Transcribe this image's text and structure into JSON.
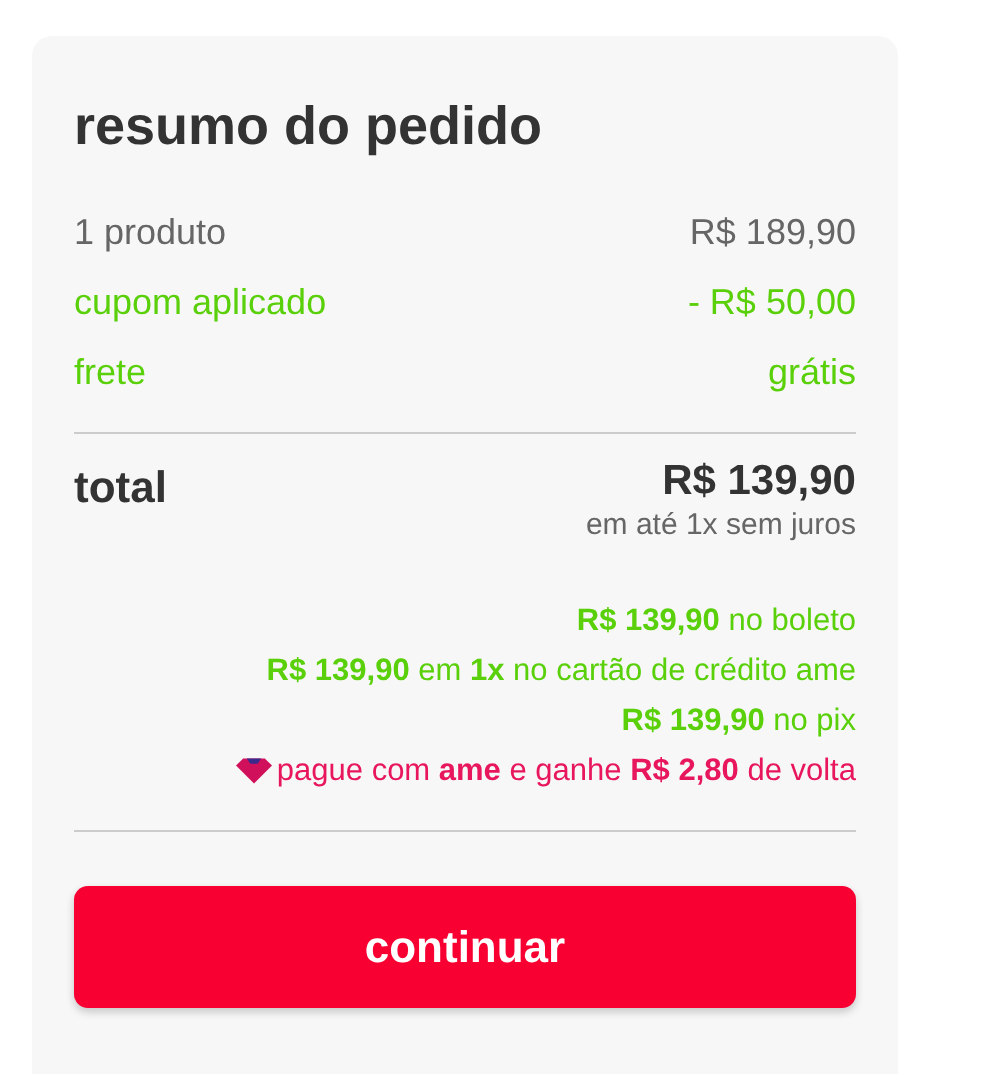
{
  "title": "resumo do pedido",
  "summary": [
    {
      "kind": "regular",
      "label": "1 produto",
      "value": "R$ 189,90"
    },
    {
      "kind": "discount",
      "label": "cupom aplicado",
      "value": "- R$ 50,00"
    },
    {
      "kind": "discount",
      "label": "frete",
      "value": "grátis"
    }
  ],
  "total": {
    "label": "total",
    "value": "R$ 139,90",
    "note": "em até 1x sem juros"
  },
  "payment_options": [
    {
      "kind": "price",
      "text": "**R$ 139,90** no boleto"
    },
    {
      "kind": "price",
      "text": "**R$ 139,90** em **1x** no cartão de crédito ame"
    },
    {
      "kind": "price",
      "text": "**R$ 139,90** no pix"
    },
    {
      "kind": "cashback",
      "text": "pague com **ame** e ganhe **R$ 2,80** de volta"
    }
  ],
  "button": "continuar"
}
